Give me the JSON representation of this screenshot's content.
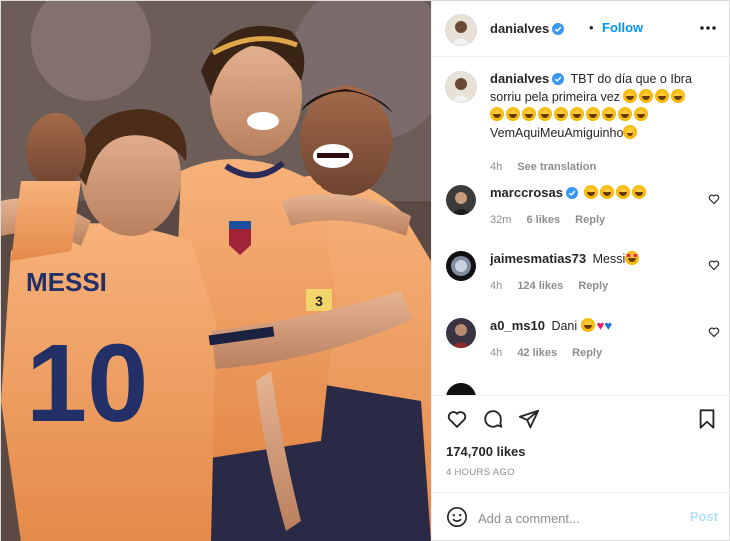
{
  "post": {
    "author": "danialves",
    "follow_label": "Follow",
    "separator": "•"
  },
  "caption": {
    "username": "danialves",
    "text_line1": "TBT do día que o Ibra",
    "text_line2": "sorriu pela primeira vez",
    "hashtag": "VemAquiMeuAmiguinho",
    "time": "4h",
    "translate": "See translation"
  },
  "comments": [
    {
      "username": "marccrosas",
      "verified": true,
      "text": "",
      "emoji_count": 4,
      "time": "32m",
      "likes": "6 likes",
      "reply": "Reply"
    },
    {
      "username": "jaimesmatias73",
      "verified": false,
      "text": "Messi",
      "time": "4h",
      "likes": "124 likes",
      "reply": "Reply"
    },
    {
      "username": "a0_ms10",
      "verified": false,
      "text": "Dani",
      "time": "4h",
      "likes": "42 likes",
      "reply": "Reply"
    }
  ],
  "photo": {
    "jersey_name": "MESSI",
    "jersey_number": "10",
    "badge_text": "3"
  },
  "likes_count": "174,700 likes",
  "time_ago": "4 HOURS AGO",
  "comment_box": {
    "placeholder": "Add a comment...",
    "post_label": "Post"
  },
  "colors": {
    "link_blue": "#0095f6",
    "post_disabled": "#b2dffc",
    "border": "#dbdbdb",
    "meta_gray": "#8e8e8e",
    "jersey_orange": "#f2a05f"
  },
  "icons": {
    "more": "more-horizontal-icon",
    "like": "heart-outline-icon",
    "comment": "comment-bubble-icon",
    "share": "paper-plane-icon",
    "save": "bookmark-icon",
    "emoji": "smiley-icon",
    "verified": "verified-badge-icon"
  }
}
